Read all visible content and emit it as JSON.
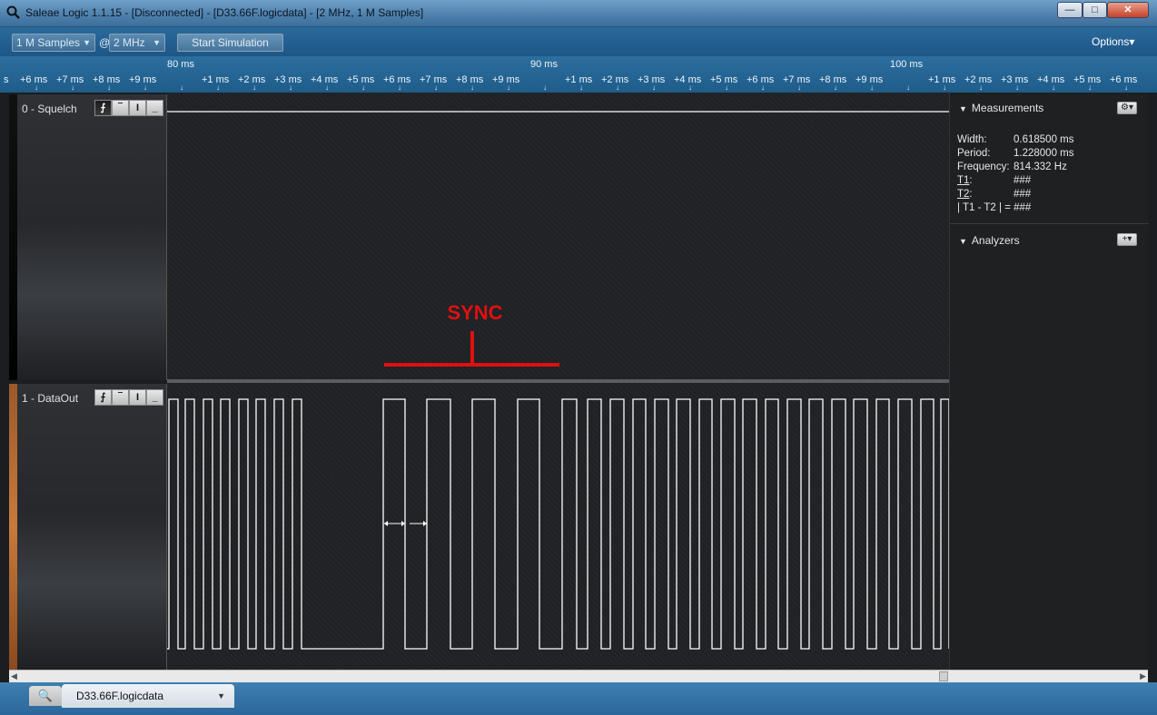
{
  "window": {
    "title": "Saleae Logic 1.1.15 - [Disconnected] - [D33.66F.logicdata] - [2 MHz, 1 M Samples]",
    "minimize_glyph": "—",
    "maximize_glyph": "□",
    "close_glyph": "✕"
  },
  "toolbar": {
    "samples_value": "1 M Samples",
    "at_label": "@",
    "rate_value": "2 MHz",
    "start_simulation_label": "Start Simulation",
    "options_label": "Options▾"
  },
  "ruler": {
    "major": [
      "80 ms",
      "90 ms",
      "100 ms"
    ],
    "minor": [
      "s",
      "+6 ms",
      "+7 ms",
      "+8 ms",
      "+9 ms",
      "+1 ms",
      "+2 ms",
      "+3 ms",
      "+4 ms",
      "+5 ms",
      "+6 ms",
      "+7 ms",
      "+8 ms",
      "+9 ms",
      "+1 ms",
      "+2 ms",
      "+3 ms",
      "+4 ms",
      "+5 ms",
      "+6 ms",
      "+7 ms",
      "+8 ms",
      "+9 ms",
      "+1 ms",
      "+2 ms",
      "+3 ms",
      "+4 ms",
      "+5 ms",
      "+6 ms"
    ]
  },
  "channels": [
    {
      "name": "0 - Squelch",
      "stripe_color": "#000000"
    },
    {
      "name": "1 - DataOut",
      "stripe_color": "#c77a3c"
    }
  ],
  "trigger_buttons": [
    "⨍",
    "‾",
    "Ɩ",
    "_"
  ],
  "annotation": {
    "label": "SYNC",
    "color": "#e01010"
  },
  "measurements": {
    "header": "Measurements",
    "rows": [
      {
        "key": "Width:",
        "value": "0.618500 ms"
      },
      {
        "key": "Period:",
        "value": "1.228000 ms"
      },
      {
        "key": "Frequency:",
        "value": "814.332 Hz"
      },
      {
        "key": "T1",
        "value": "###"
      },
      {
        "key": "T2",
        "value": "###"
      },
      {
        "key": "| T1 - T2 | =",
        "value": "###"
      }
    ]
  },
  "analyzers": {
    "header": "Analyzers"
  },
  "tabs": {
    "search_icon": "🔍",
    "file_tab_label": "D33.66F.logicdata"
  },
  "colors": {
    "accent": "#1f5c8a",
    "wave": "#ffffff",
    "sync": "#e01010"
  }
}
